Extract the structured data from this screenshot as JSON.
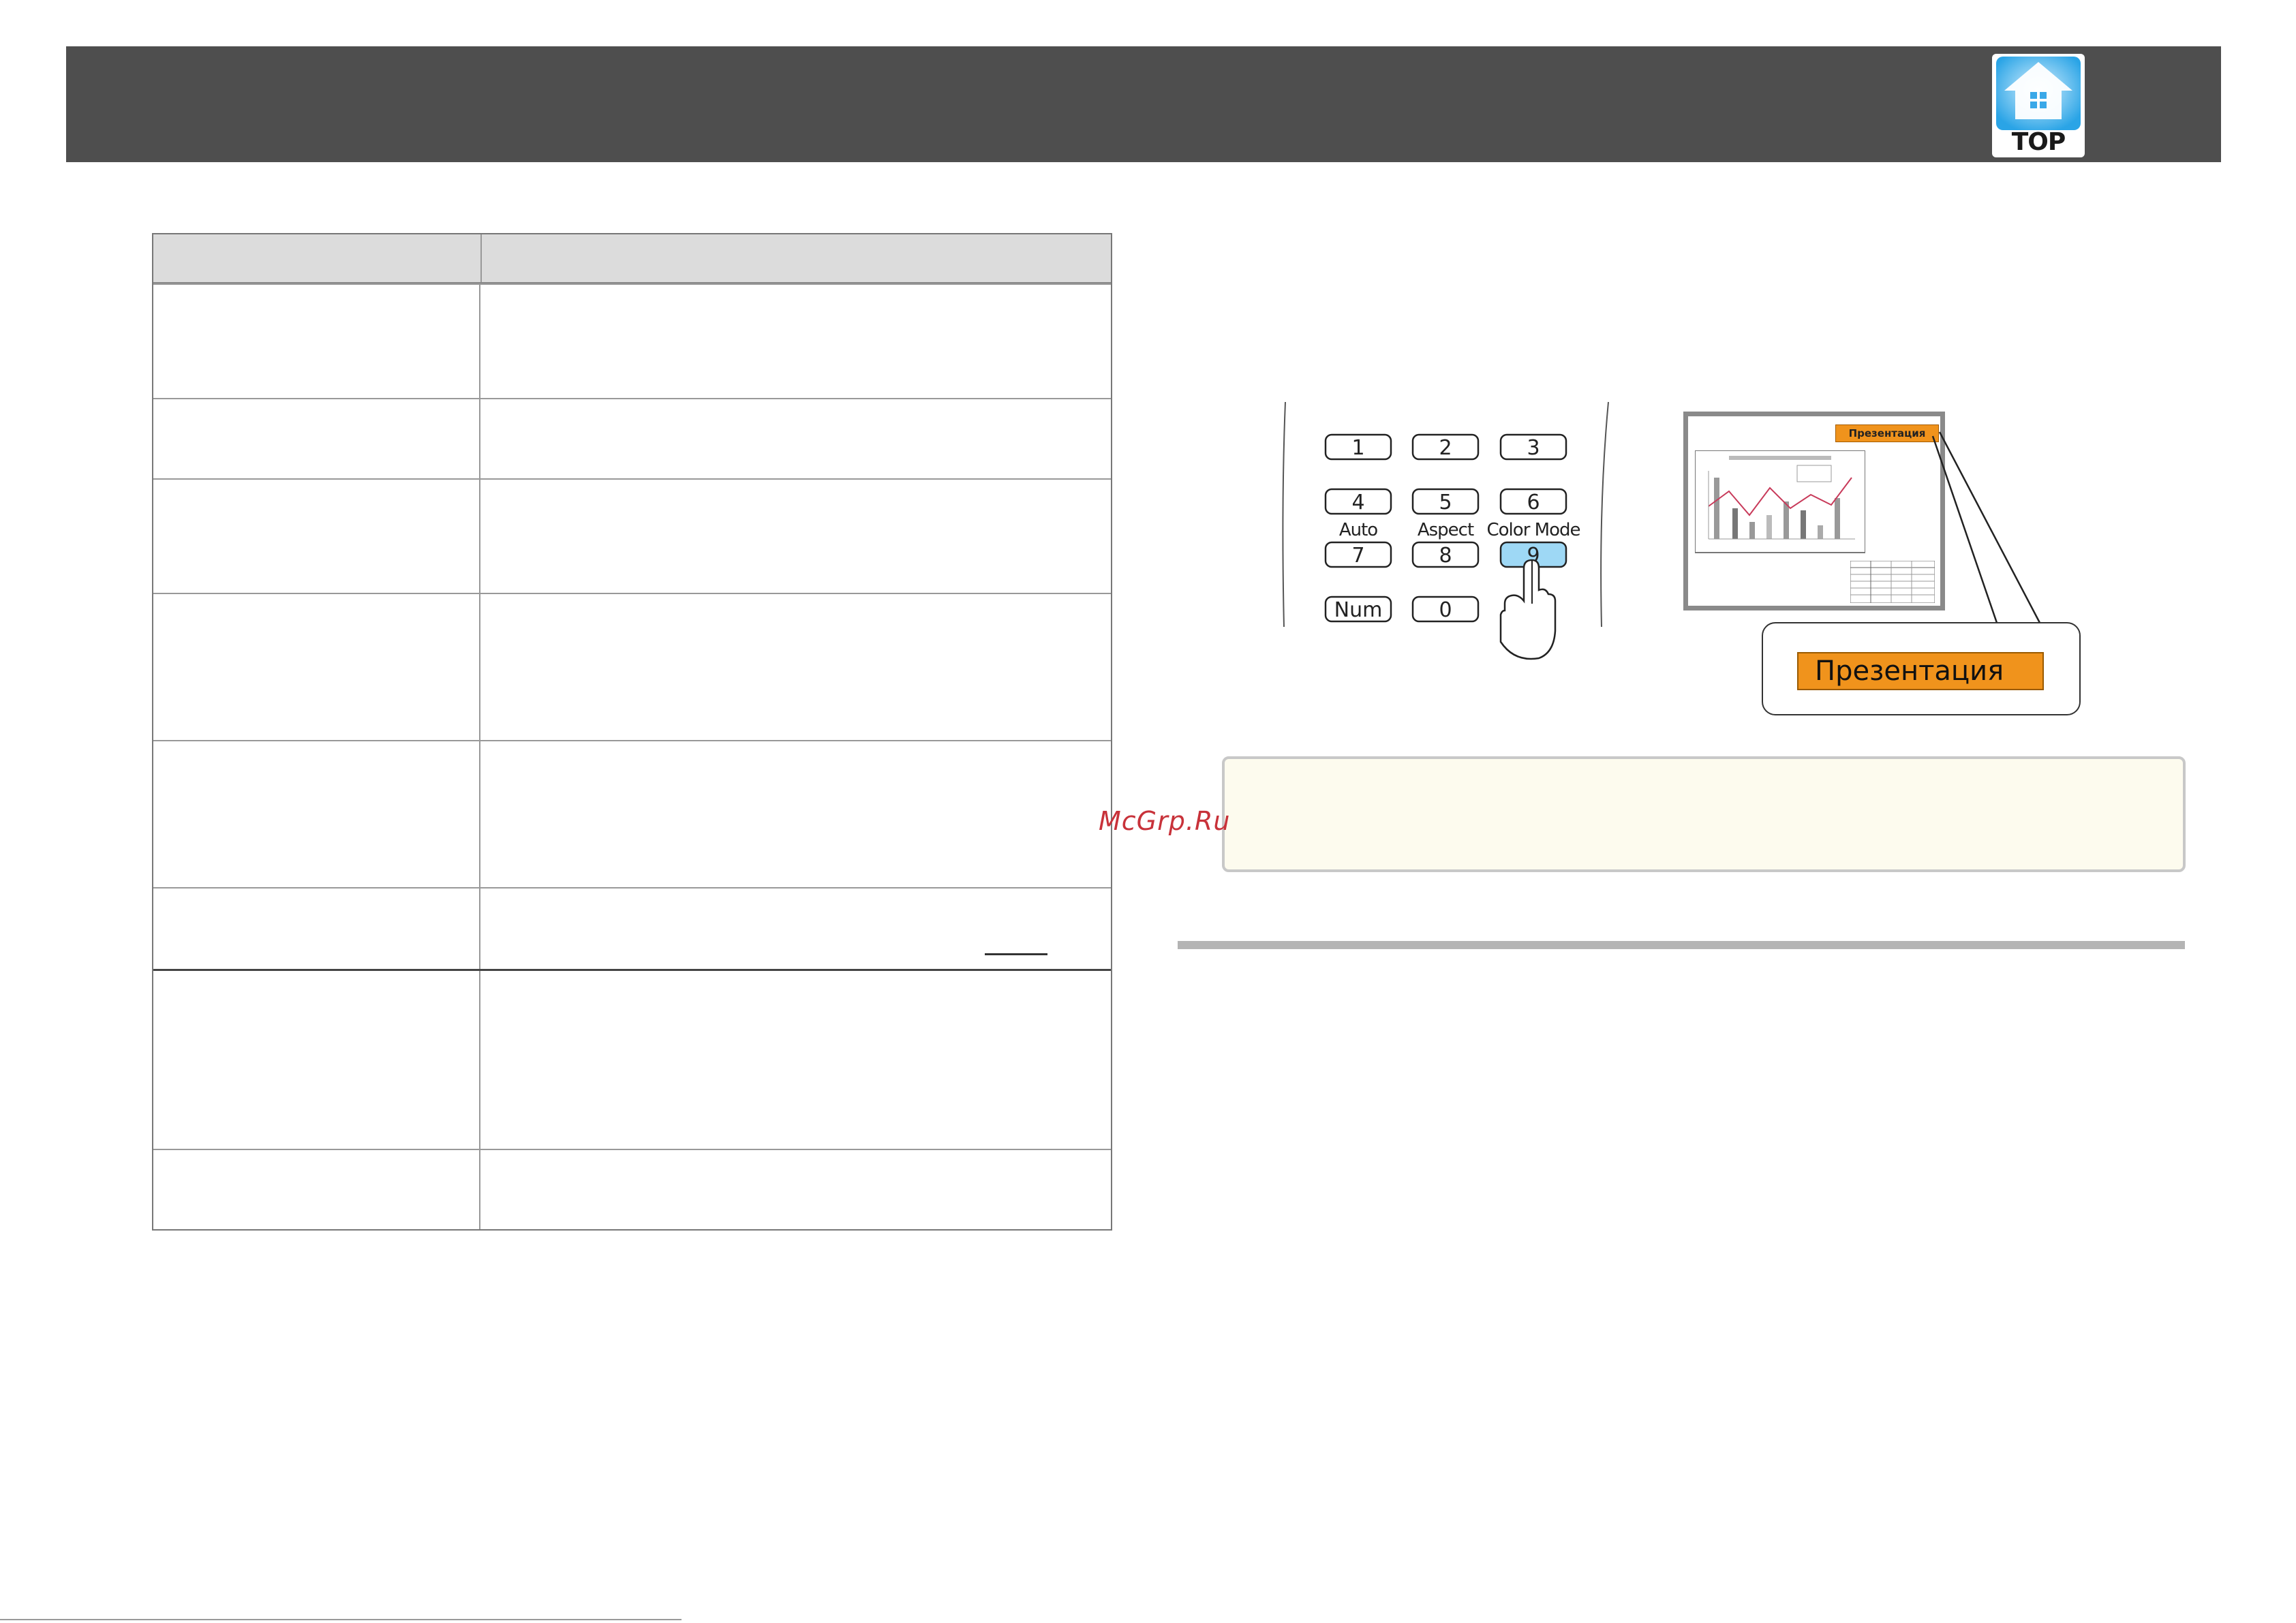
{
  "header": {
    "top_button_label": "TOP",
    "top_icon": "house-icon"
  },
  "table": {
    "row_count": 8
  },
  "remote": {
    "keys": [
      "1",
      "2",
      "3",
      "4",
      "5",
      "6",
      "7",
      "8",
      "9",
      "Num",
      "0"
    ],
    "captions": [
      "Auto",
      "Aspect",
      "Color Mode"
    ],
    "pressed_key": "9",
    "highlight_color": "#9ed8f5"
  },
  "screen": {
    "badge_text": "Презентация",
    "badge_color": "#f0931c"
  },
  "callout": {
    "label": "Презентация"
  },
  "watermark": {
    "text": "McGrp.Ru"
  }
}
